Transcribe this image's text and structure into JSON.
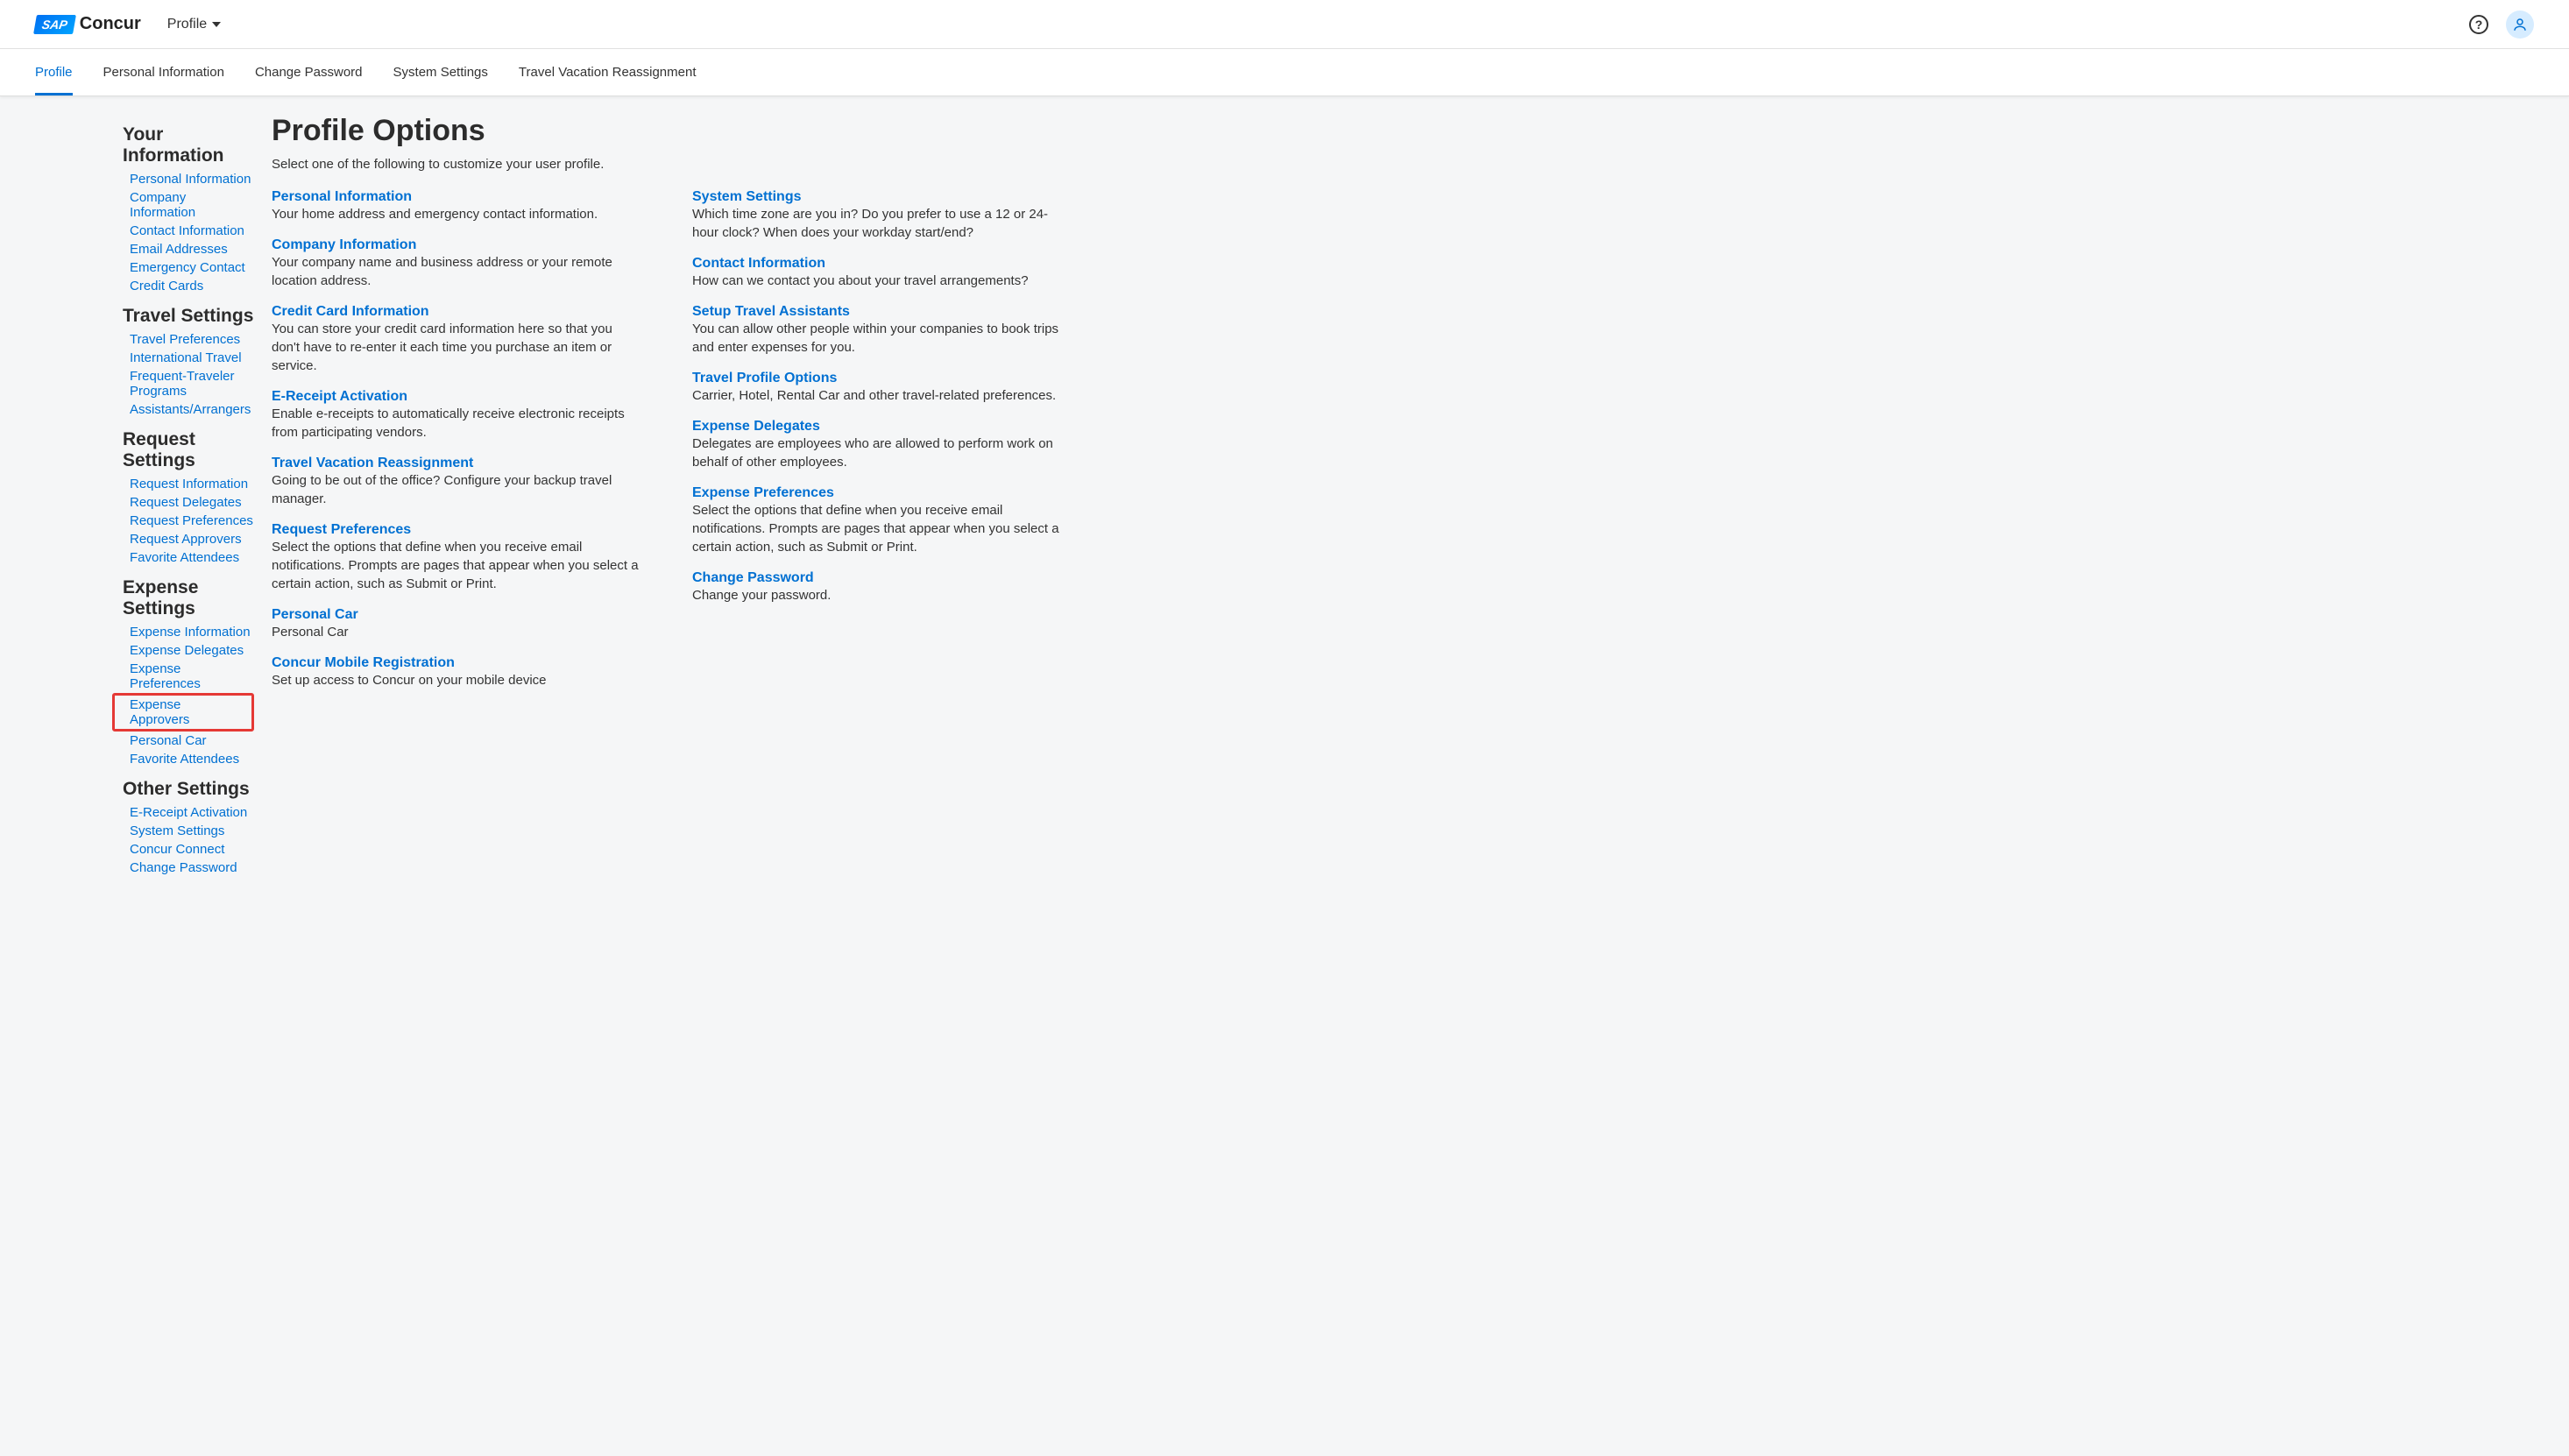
{
  "header": {
    "logo_sap": "SAP",
    "logo_concur": "Concur",
    "profile_label": "Profile"
  },
  "nav": [
    {
      "label": "Profile",
      "active": true
    },
    {
      "label": "Personal Information"
    },
    {
      "label": "Change Password"
    },
    {
      "label": "System Settings"
    },
    {
      "label": "Travel Vacation Reassignment"
    }
  ],
  "sidebar": [
    {
      "title": "Your Information",
      "links": [
        {
          "label": "Personal Information"
        },
        {
          "label": "Company Information"
        },
        {
          "label": "Contact Information"
        },
        {
          "label": "Email Addresses"
        },
        {
          "label": "Emergency Contact"
        },
        {
          "label": "Credit Cards"
        }
      ]
    },
    {
      "title": "Travel Settings",
      "links": [
        {
          "label": "Travel Preferences"
        },
        {
          "label": "International Travel"
        },
        {
          "label": "Frequent-Traveler Programs"
        },
        {
          "label": "Assistants/Arrangers"
        }
      ]
    },
    {
      "title": "Request Settings",
      "links": [
        {
          "label": "Request Information"
        },
        {
          "label": "Request Delegates"
        },
        {
          "label": "Request Preferences"
        },
        {
          "label": "Request Approvers"
        },
        {
          "label": "Favorite Attendees"
        }
      ]
    },
    {
      "title": "Expense Settings",
      "links": [
        {
          "label": "Expense Information"
        },
        {
          "label": "Expense Delegates"
        },
        {
          "label": "Expense Preferences"
        },
        {
          "label": "Expense Approvers",
          "highlight": true
        },
        {
          "label": "Personal Car"
        },
        {
          "label": "Favorite Attendees"
        }
      ]
    },
    {
      "title": "Other Settings",
      "links": [
        {
          "label": "E-Receipt Activation"
        },
        {
          "label": "System Settings"
        },
        {
          "label": "Concur Connect"
        },
        {
          "label": "Change Password"
        }
      ]
    }
  ],
  "main": {
    "heading": "Profile Options",
    "subtitle": "Select one of the following to customize your user profile.",
    "left": [
      {
        "title": "Personal Information",
        "desc": "Your home address and emergency contact information."
      },
      {
        "title": "Company Information",
        "desc": "Your company name and business address or your remote location address."
      },
      {
        "title": "Credit Card Information",
        "desc": "You can store your credit card information here so that you don't have to re-enter it each time you purchase an item or service."
      },
      {
        "title": "E-Receipt Activation",
        "desc": "Enable e-receipts to automatically receive electronic receipts from participating vendors."
      },
      {
        "title": "Travel Vacation Reassignment",
        "desc": "Going to be out of the office? Configure your backup travel manager."
      },
      {
        "title": "Request Preferences",
        "desc": "Select the options that define when you receive email notifications. Prompts are pages that appear when you select a certain action, such as Submit or Print."
      },
      {
        "title": "Personal Car",
        "desc": "Personal Car"
      },
      {
        "title": "Concur Mobile Registration",
        "desc": "Set up access to Concur on your mobile device"
      }
    ],
    "right": [
      {
        "title": "System Settings",
        "desc": "Which time zone are you in? Do you prefer to use a 12 or 24-hour clock? When does your workday start/end?"
      },
      {
        "title": "Contact Information",
        "desc": "How can we contact you about your travel arrangements?"
      },
      {
        "title": "Setup Travel Assistants",
        "desc": "You can allow other people within your companies to book trips and enter expenses for you."
      },
      {
        "title": "Travel Profile Options",
        "desc": "Carrier, Hotel, Rental Car and other travel-related preferences."
      },
      {
        "title": "Expense Delegates",
        "desc": "Delegates are employees who are allowed to perform work on behalf of other employees."
      },
      {
        "title": "Expense Preferences",
        "desc": "Select the options that define when you receive email notifications. Prompts are pages that appear when you select a certain action, such as Submit or Print."
      },
      {
        "title": "Change Password",
        "desc": "Change your password."
      }
    ]
  }
}
